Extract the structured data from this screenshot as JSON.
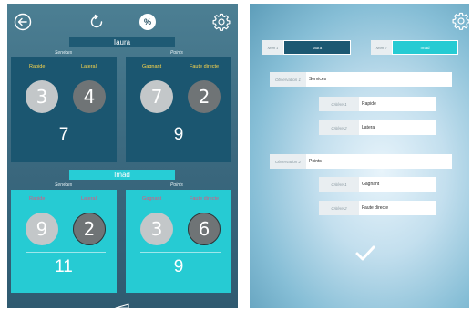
{
  "left_screen": {
    "toolbar": {
      "back_icon": "circle-arrow-left-icon",
      "refresh_icon": "refresh-icon",
      "percent_label": "%",
      "settings_icon": "gear-icon"
    },
    "team1": {
      "name": "Iaura",
      "services": {
        "section_label": "Services",
        "criterion1_label": "Rapide",
        "criterion2_label": "Lateral",
        "value1": "3",
        "value2": "4",
        "total": "7"
      },
      "points": {
        "section_label": "Points",
        "criterion1_label": "Gagnant",
        "criterion2_label": "Faute directe",
        "value1": "7",
        "value2": "2",
        "total": "9"
      }
    },
    "team2": {
      "name": "Imad",
      "services": {
        "section_label": "Services",
        "criterion1_label": "Rapide",
        "criterion2_label": "Lateral",
        "value1": "9",
        "value2": "2",
        "total": "11"
      },
      "points": {
        "section_label": "Points",
        "criterion1_label": "Gagnant",
        "criterion2_label": "Faute directe",
        "value1": "3",
        "value2": "6",
        "total": "9"
      }
    },
    "bottom_nav_icon": "back-triangle-icon",
    "colors": {
      "team1_card": "#1b5670",
      "team2_card": "#26cbd3",
      "team1_labels": "#ffd84a",
      "team2_labels": "#e6527a"
    }
  },
  "right_screen": {
    "settings_icon": "gear-icon",
    "nom1": {
      "label": "Nom 1",
      "value": "Iaura"
    },
    "nom2": {
      "label": "Nom 2",
      "value": "Imad"
    },
    "observation1": {
      "label": "Observation 1",
      "value": "Services",
      "criteria": [
        {
          "label": "Critère 1",
          "value": "Rapide"
        },
        {
          "label": "Critère 2",
          "value": "Lateral"
        }
      ]
    },
    "observation2": {
      "label": "Observation 2",
      "value": "Points",
      "criteria": [
        {
          "label": "Critère 1",
          "value": "Gagnant"
        },
        {
          "label": "Critère 2",
          "value": "Faute directe"
        }
      ]
    },
    "confirm_icon": "checkmark-icon"
  }
}
